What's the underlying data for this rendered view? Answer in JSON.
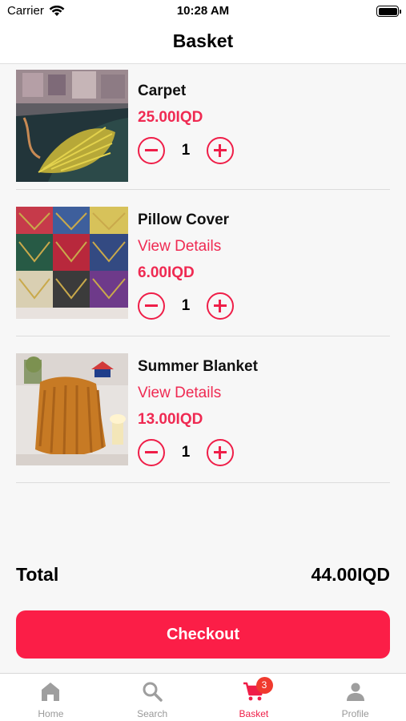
{
  "status_bar": {
    "carrier": "Carrier",
    "time": "10:28 AM"
  },
  "header": {
    "title": "Basket"
  },
  "items": [
    {
      "name": "Carpet",
      "price": "25.00IQD",
      "quantity": "1"
    },
    {
      "name": "Pillow Cover",
      "details_link": "View Details",
      "price": "6.00IQD",
      "quantity": "1"
    },
    {
      "name": "Summer Blanket",
      "details_link": "View Details",
      "price": "13.00IQD",
      "quantity": "1"
    }
  ],
  "summary": {
    "total_label": "Total",
    "total_value": "44.00IQD"
  },
  "checkout": {
    "label": "Checkout"
  },
  "tab_bar": {
    "tabs": [
      {
        "label": "Home",
        "icon": "home-icon"
      },
      {
        "label": "Search",
        "icon": "search-icon"
      },
      {
        "label": "Basket",
        "icon": "cart-icon",
        "badge": "3",
        "active": true
      },
      {
        "label": "Profile",
        "icon": "person-icon"
      }
    ]
  },
  "colors": {
    "accent": "#fb1e47",
    "price": "#ef2a52",
    "badge": "#f03a2e",
    "inactive_tab": "#999999"
  }
}
